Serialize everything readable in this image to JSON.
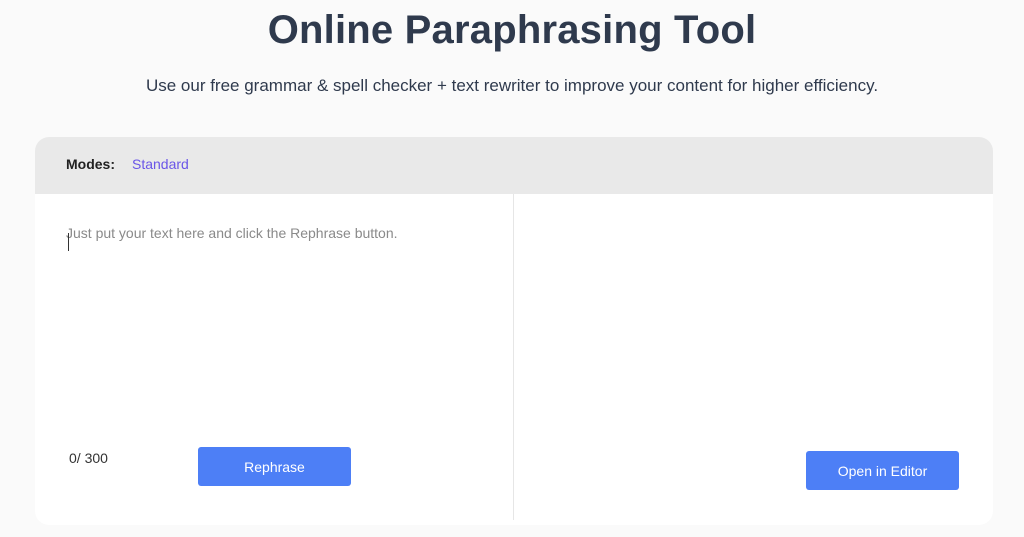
{
  "header": {
    "title": "Online Paraphrasing Tool",
    "subtitle": "Use our free grammar & spell checker + text rewriter to improve your content for higher efficiency."
  },
  "modes": {
    "label": "Modes:",
    "selected": "Standard"
  },
  "input": {
    "value": "",
    "placeholder": "Just put your text here and click the Rephrase button.",
    "counter": "0/ 300"
  },
  "actions": {
    "rephrase_label": "Rephrase",
    "open_editor_label": "Open in Editor"
  },
  "colors": {
    "accent": "#4d7ff6",
    "mode_link": "#6a55e8",
    "title": "#2f3a4d"
  }
}
